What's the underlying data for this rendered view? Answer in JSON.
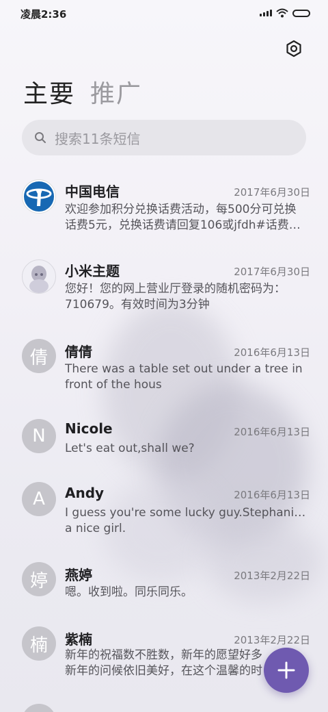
{
  "status_bar": {
    "time": "凌晨2:36"
  },
  "tabs": [
    {
      "label": "主要",
      "active": true
    },
    {
      "label": "推广",
      "active": false
    }
  ],
  "search": {
    "placeholder": "搜索11条短信"
  },
  "messages": [
    {
      "name": "中国电信",
      "date": "2017年6月30日",
      "avatar": "china-telecom-logo",
      "lines": [
        "欢迎参加积分兑换话费活动，每500分可兑换",
        "话费5元，兑换话费请回复106或jfdh#话费…"
      ]
    },
    {
      "name": "小米主题",
      "date": "2017年6月30日",
      "avatar": "theme-photo",
      "lines": [
        "您好！您的网上营业厅登录的随机密码为：",
        "710679。有效时间为3分钟"
      ]
    },
    {
      "name": "倩倩",
      "date": "2016年6月13日",
      "avatar_letter": "倩",
      "lines": [
        "There was a table set out under a tree in",
        "front of the hous"
      ]
    },
    {
      "name": "Nicole",
      "date": "2016年6月13日",
      "avatar_letter": "N",
      "lines": [
        "Let's eat out,shall we?"
      ]
    },
    {
      "name": "Andy",
      "date": "2016年6月13日",
      "avatar_letter": "A",
      "lines": [
        "I guess you're some lucky guy.Stephanie is",
        "a nice girl."
      ]
    },
    {
      "name": "燕婷",
      "date": "2013年2月22日",
      "avatar_letter": "婷",
      "lines": [
        "嗯。收到啦。同乐同乐。"
      ]
    },
    {
      "name": "紫楠",
      "date": "2013年2月22日",
      "avatar_letter": "楠",
      "lines": [
        "新年的祝福数不胜数，新年的愿望好多",
        "新年的问候依旧美好，在这个温馨的时"
      ]
    }
  ],
  "colors": {
    "accent": "#6f5ab0",
    "avatar_bg": "#c6c5cb",
    "telecom_blue": "#1768b3"
  }
}
